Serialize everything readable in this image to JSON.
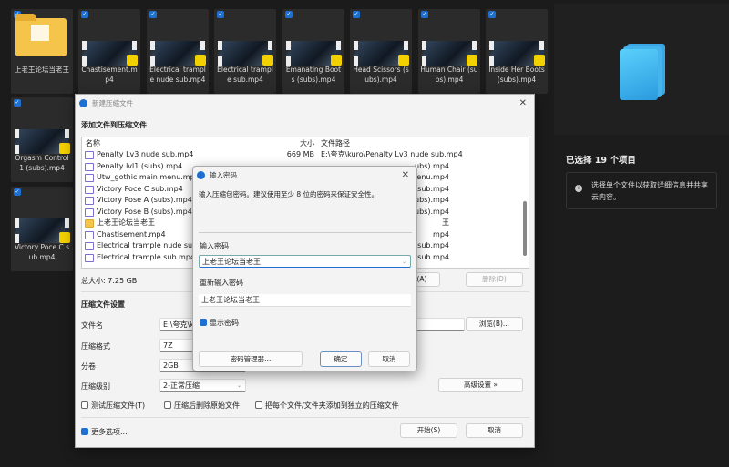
{
  "tiles": [
    {
      "name": "上老王论坛当老王",
      "type": "folder"
    },
    {
      "name": "Chastisement.mp4",
      "type": "video"
    },
    {
      "name": "Electrical trample nude sub.mp4",
      "type": "video"
    },
    {
      "name": "Electrical trample sub.mp4",
      "type": "video"
    },
    {
      "name": "Emanating Boots (subs).mp4",
      "type": "video"
    },
    {
      "name": "Head Scissors (subs).mp4",
      "type": "video"
    },
    {
      "name": "Human Chair (subs).mp4",
      "type": "video"
    },
    {
      "name": "Inside Her Boots (subs).mp4",
      "type": "video"
    },
    {
      "name": "Orgasm Control 1 (subs).mp4",
      "type": "video"
    },
    {
      "name": "Victory Poce C sub.mp4",
      "type": "video"
    }
  ],
  "details": {
    "selected": "已选择 19 个项目",
    "info": "选择单个文件以获取详细信息并共享云内容。",
    "icon": "info-icon"
  },
  "archive_dialog": {
    "title": "新建压缩文件",
    "section_add": "添加文件到压缩文件",
    "columns": {
      "name": "名称",
      "size": "大小",
      "path": "文件路径"
    },
    "files": [
      {
        "name": "Penalty Lv3 nude sub.mp4",
        "size": "669 MB",
        "path": "E:\\夸克\\kuro\\Penalty Lv3 nude sub.mp4"
      },
      {
        "name": "Penalty lvl1 (subs).mp4",
        "size": "",
        "path": "ubs).mp4"
      },
      {
        "name": "Utw_gothic main menu.mp4",
        "size": "",
        "path": "in menu.mp4"
      },
      {
        "name": "Victory Poce C sub.mp4",
        "size": "",
        "path": "sub.mp4"
      },
      {
        "name": "Victory Pose A (subs).mp4",
        "size": "",
        "path": "(subs).mp4"
      },
      {
        "name": "Victory Pose B (subs).mp4",
        "size": "",
        "path": "(subs).mp4"
      },
      {
        "name": "上老王论坛当老王",
        "size": "",
        "path": "王",
        "folder": true
      },
      {
        "name": "Chastisement.mp4",
        "size": "",
        "path": "mp4"
      },
      {
        "name": "Electrical trample nude sub.mp4",
        "size": "",
        "path": "ple nude sub.mp4"
      },
      {
        "name": "Electrical trample sub.mp4",
        "size": "",
        "path": "ple sub.mp4"
      }
    ],
    "total_size": "总大小: 7.25 GB",
    "add_button": "添加(A)",
    "delete_button": "删除(D)",
    "section_settings": "压缩文件设置",
    "filename_label": "文件名",
    "filename_value": "E:\\夸克\\kuro",
    "browse_button": "浏览(B)...",
    "format_label": "压缩格式",
    "format_value": "7Z",
    "split_label": "分卷",
    "split_value": "2GB",
    "level_label": "压缩级别",
    "level_value": "2-正常压缩",
    "advanced_button": "高级设置 »",
    "test_checkbox": "测试压缩文件(T)",
    "delete_after_checkbox": "压缩后删除原始文件",
    "separate_checkbox": "把每个文件/文件夹添加到独立的压缩文件",
    "more_options": "更多选项...",
    "start_button": "开始(S)",
    "cancel_button": "取消"
  },
  "password_dialog": {
    "title": "输入密码",
    "hint": "输入压缩包密码。建议使用至少 8 位的密码来保证安全性。",
    "password_label": "输入密码",
    "password_value": "上老王论坛当老王",
    "reenter_label": "重新输入密码",
    "reenter_value": "上老王论坛当老王",
    "show_password": "显示密码",
    "show_password_checked": true,
    "manager_button": "密码管理器...",
    "ok_button": "确定",
    "cancel_button": "取消"
  },
  "colors": {
    "accent": "#1d6fd1",
    "background": "#1b1b1b"
  }
}
